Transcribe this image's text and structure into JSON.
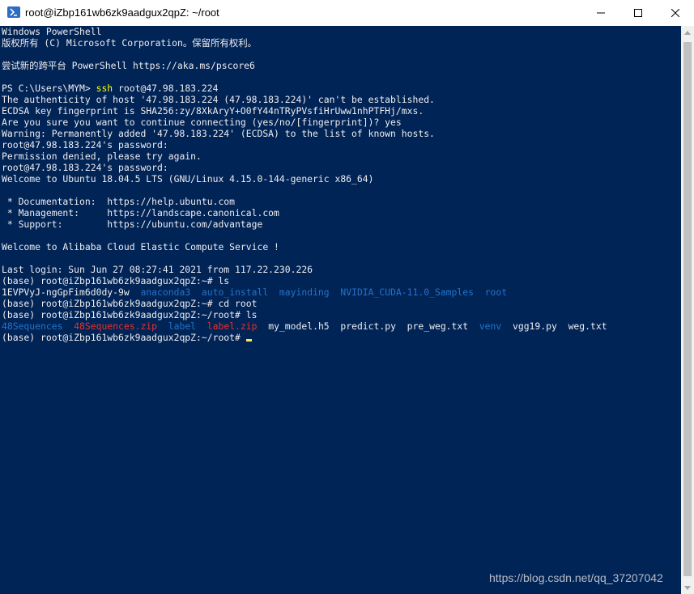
{
  "window": {
    "title": "root@iZbp161wb6zk9aadgux2qpZ: ~/root",
    "icon": "powershell-icon",
    "accent": "#012456"
  },
  "terminal": {
    "l01": "Windows PowerShell",
    "l02": "版权所有 (C) Microsoft Corporation。保留所有权利。",
    "l04": "尝试新的跨平台 PowerShell https://aka.ms/pscore6",
    "l06_prompt": "PS C:\\Users\\MYM> ",
    "l06_cmd": "ssh",
    "l06_args": " root@47.98.183.224",
    "l07": "The authenticity of host '47.98.183.224 (47.98.183.224)' can't be established.",
    "l08": "ECDSA key fingerprint is SHA256:zy/8XkAryY+O0fY44nTRyPVsfiHrUww1nhPTFHj/mxs.",
    "l09": "Are you sure you want to continue connecting (yes/no/[fingerprint])? yes",
    "l10": "Warning: Permanently added '47.98.183.224' (ECDSA) to the list of known hosts.",
    "l11": "root@47.98.183.224's password:",
    "l12": "Permission denied, please try again.",
    "l13": "root@47.98.183.224's password:",
    "l14": "Welcome to Ubuntu 18.04.5 LTS (GNU/Linux 4.15.0-144-generic x86_64)",
    "l16": " * Documentation:  https://help.ubuntu.com",
    "l17": " * Management:     https://landscape.canonical.com",
    "l18": " * Support:        https://ubuntu.com/advantage",
    "l20": "Welcome to Alibaba Cloud Elastic Compute Service !",
    "l22": "Last login: Sun Jun 27 08:27:41 2021 from 117.22.230.226",
    "l23": "(base) root@iZbp161wb6zk9aadgux2qpZ:~# ls",
    "l24_file": "1EVPVyJ-ngGpFim6d0dy-9w",
    "l24_d1": "anaconda3",
    "l24_d2": "auto_install",
    "l24_d3": "mayinding",
    "l24_d4": "NVIDIA_CUDA-11.0_Samples",
    "l24_d5": "root",
    "l25": "(base) root@iZbp161wb6zk9aadgux2qpZ:~# cd root",
    "l26": "(base) root@iZbp161wb6zk9aadgux2qpZ:~/root# ls",
    "l27_d1": "48Sequences",
    "l27_z1": "48Sequences.zip",
    "l27_d2": "label",
    "l27_z2": "label.zip",
    "l27_f1": "my_model.h5",
    "l27_f2": "predict.py",
    "l27_f3": "pre_weg.txt",
    "l27_d3": "venv",
    "l27_f4": "vgg19.py",
    "l27_f5": "weg.txt",
    "l28": "(base) root@iZbp161wb6zk9aadgux2qpZ:~/root# "
  },
  "watermark": "https://blog.csdn.net/qq_37207042"
}
